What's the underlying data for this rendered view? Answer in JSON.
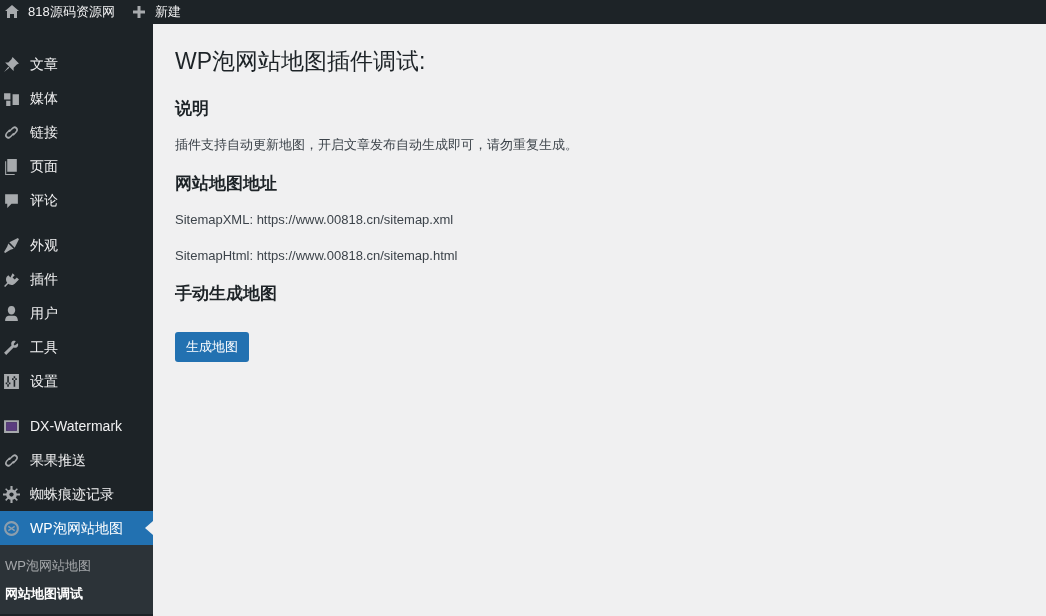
{
  "admin_bar": [
    {
      "label": "818源码资源网"
    },
    {
      "label": "新建"
    }
  ],
  "menu_groups": [
    [
      {
        "label": "文章",
        "selected": false
      },
      {
        "label": "媒体",
        "selected": false
      },
      {
        "label": "链接",
        "selected": false
      },
      {
        "label": "页面",
        "selected": false
      },
      {
        "label": "评论",
        "selected": false
      }
    ],
    [
      {
        "label": "外观",
        "selected": false
      },
      {
        "label": "插件",
        "selected": false
      },
      {
        "label": "用户",
        "selected": false
      },
      {
        "label": "工具",
        "selected": false
      },
      {
        "label": "设置",
        "selected": false
      }
    ],
    [
      {
        "label": "DX-Watermark",
        "selected": false
      },
      {
        "label": "果果推送",
        "selected": false
      },
      {
        "label": "蜘蛛痕迹记录",
        "selected": false
      },
      {
        "label": "WP泡网站地图",
        "selected": true,
        "submenu": [
          {
            "label": "WP泡网站地图",
            "selected": false
          },
          {
            "label": "网站地图调试",
            "selected": true
          }
        ]
      }
    ]
  ],
  "page": {
    "title": "WP泡网站地图插件调试:",
    "sections": [
      {
        "heading": "说明",
        "lines": [
          "插件支持自动更新地图，开启文章发布自动生成即可，请勿重复生成。"
        ]
      },
      {
        "heading": "网站地图地址",
        "lines": [
          "SitemapXML: https://www.00818.cn/sitemap.xml",
          "SitemapHtml: https://www.00818.cn/sitemap.html"
        ]
      },
      {
        "heading": "手动生成地图",
        "button": "生成地图"
      }
    ]
  }
}
